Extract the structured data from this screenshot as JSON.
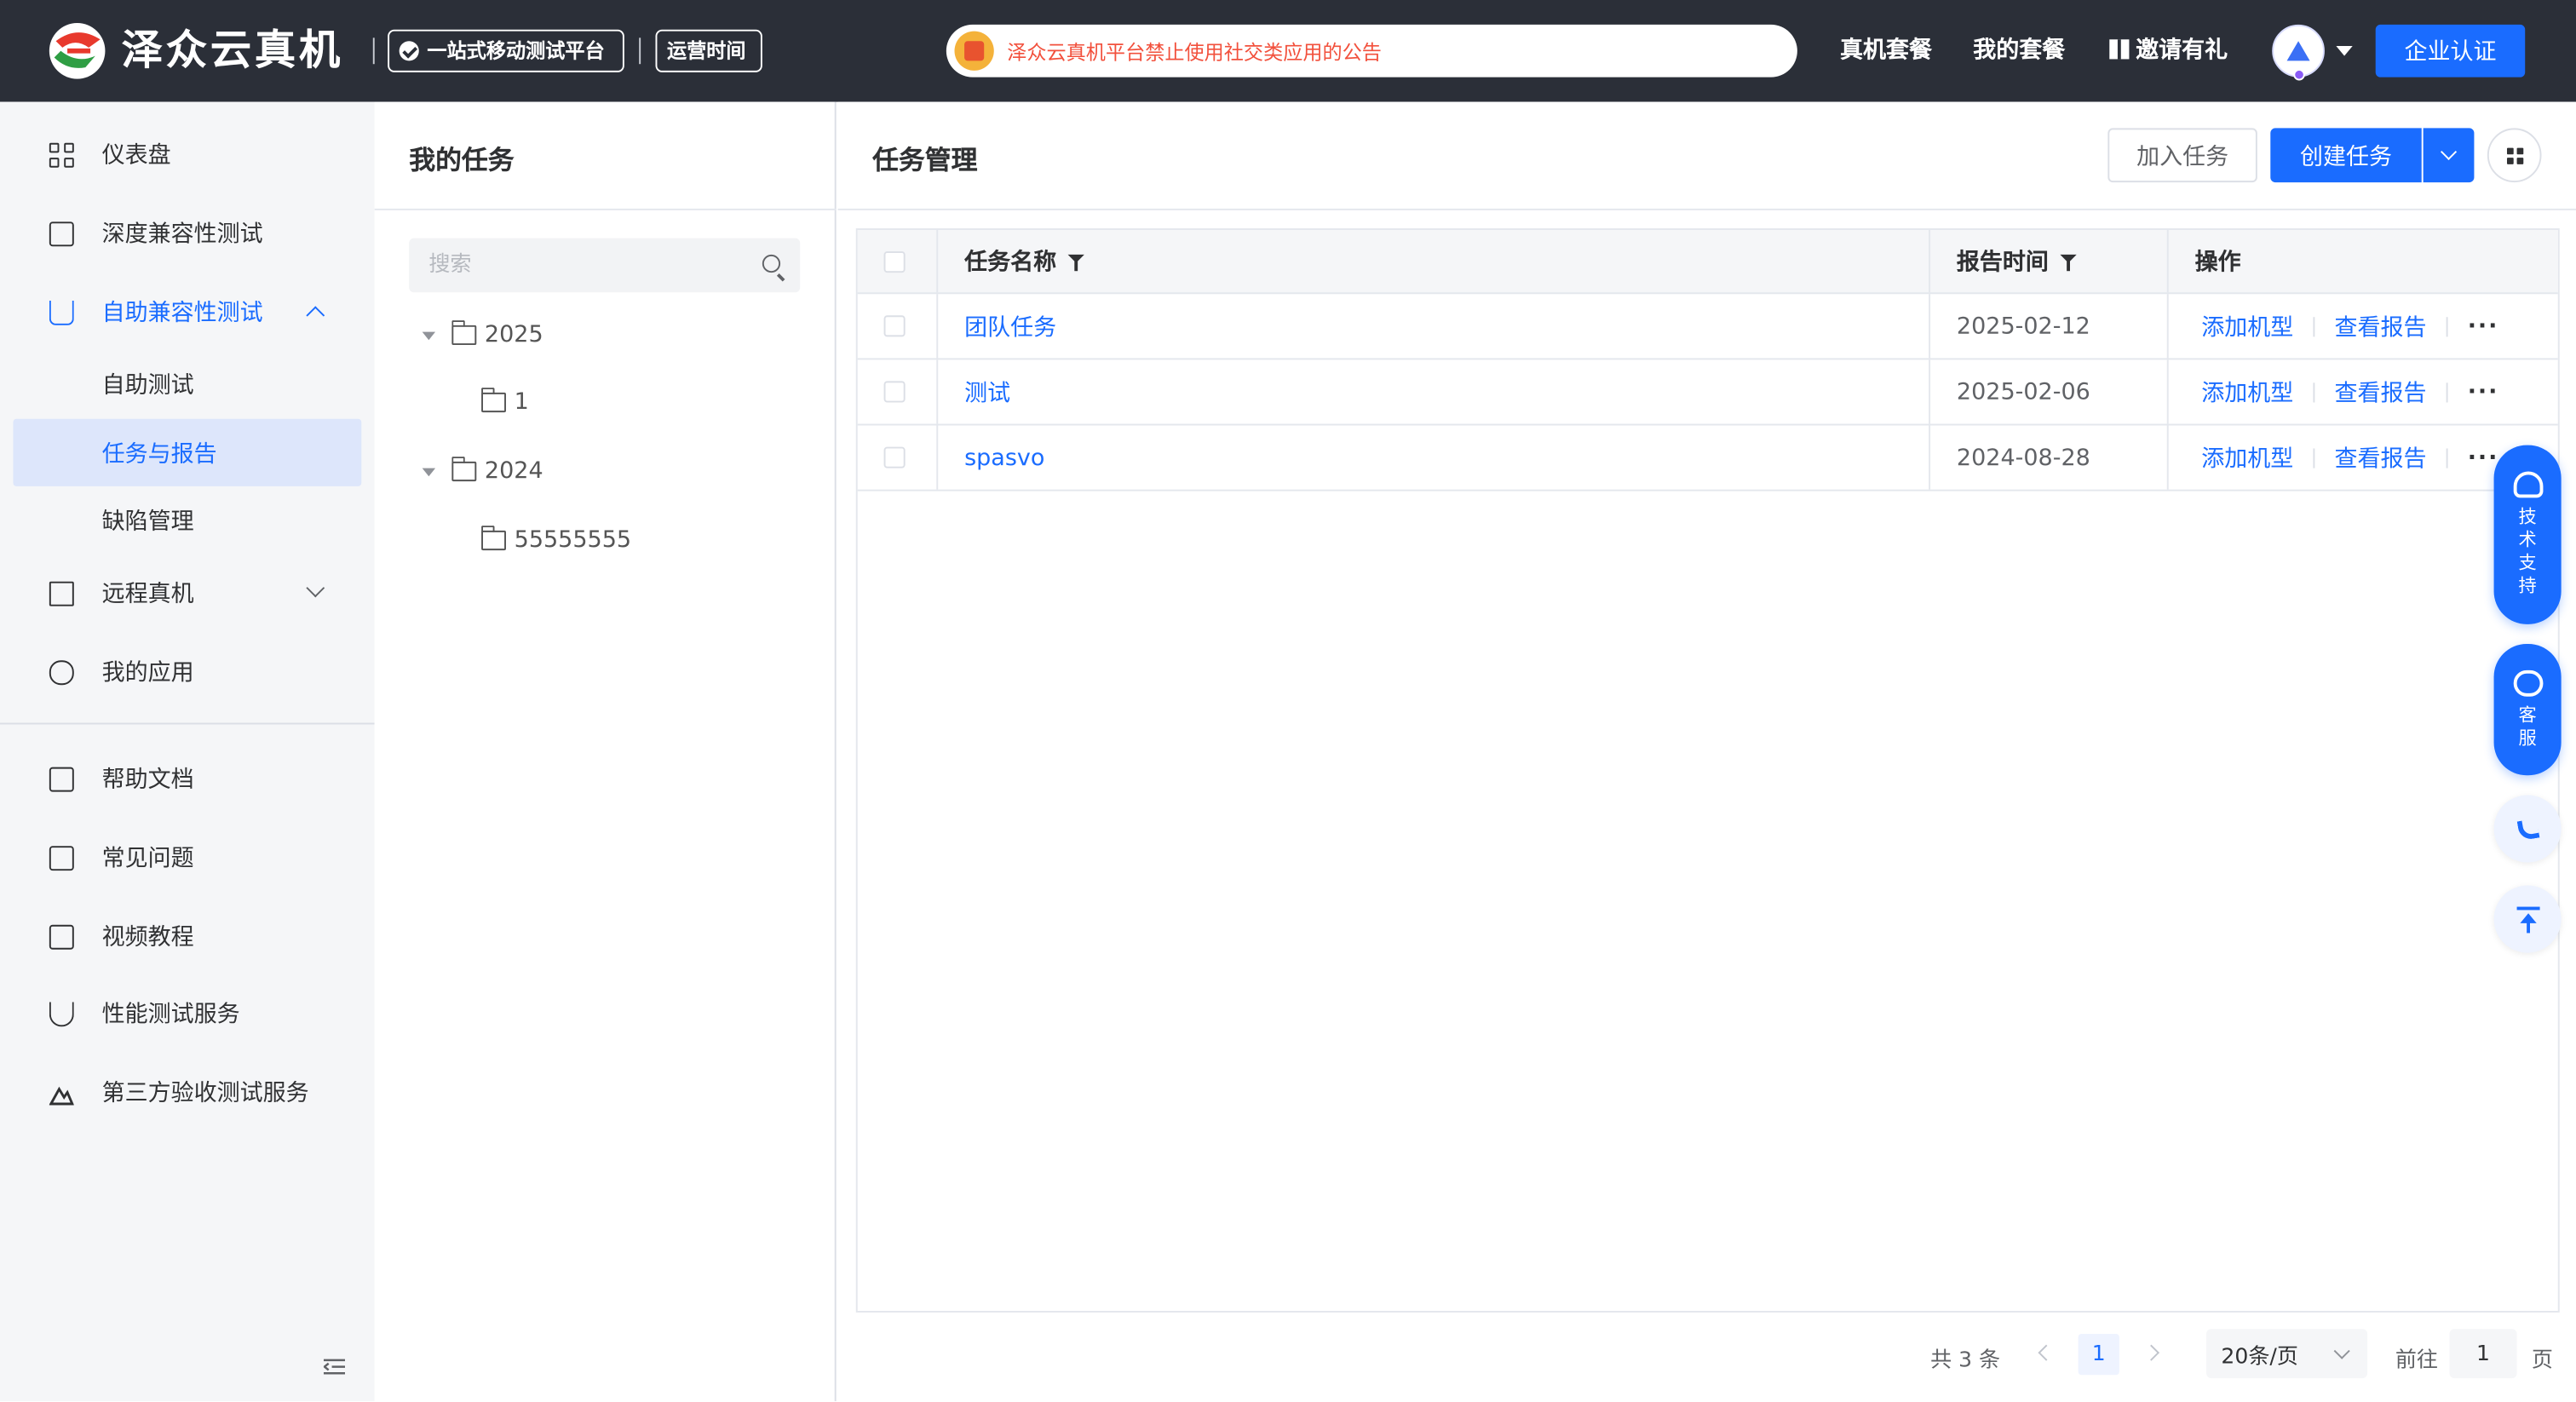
{
  "header": {
    "brand": "泽众云真机",
    "tag_platform": "一站式移动测试平台",
    "tag_hours": "运营时间",
    "notice": "泽众云真机平台禁止使用社交类应用的公告",
    "nav": [
      "真机套餐",
      "我的套餐",
      "邀请有礼"
    ],
    "enterprise_button": "企业认证",
    "avatar_icon": "user-avatar-icon",
    "colors": {
      "bar": "#2b2f38",
      "accent": "#1a6cff",
      "notice_text": "#f2503c"
    }
  },
  "sidebar": {
    "items": [
      {
        "label": "仪表盘",
        "icon": "dashboard-icon"
      },
      {
        "label": "深度兼容性测试",
        "icon": "copy-icon"
      },
      {
        "label": "自助兼容性测试",
        "icon": "flask-icon",
        "expanded": true
      },
      {
        "label": "远程真机",
        "icon": "phone-icon"
      },
      {
        "label": "我的应用",
        "icon": "app-icon"
      },
      {
        "label": "帮助文档",
        "icon": "book-icon"
      },
      {
        "label": "常见问题",
        "icon": "question-icon"
      },
      {
        "label": "视频教程",
        "icon": "video-icon"
      },
      {
        "label": "性能测试服务",
        "icon": "magnet-icon"
      },
      {
        "label": "第三方验收测试服务",
        "icon": "mountain-icon"
      }
    ],
    "sub_items": [
      "自助测试",
      "任务与报告",
      "缺陷管理"
    ],
    "selected": "任务与报告"
  },
  "tree": {
    "title": "我的任务",
    "search_placeholder": "搜索",
    "nodes": [
      {
        "label": "2025",
        "children": [
          "1"
        ]
      },
      {
        "label": "2024",
        "children": [
          "55555555"
        ]
      }
    ]
  },
  "main": {
    "title": "任务管理",
    "join_button": "加入任务",
    "create_button": "创建任务",
    "table": {
      "columns": [
        "任务名称",
        "报告时间",
        "操作"
      ],
      "rows": [
        {
          "name": "团队任务",
          "time": "2025-02-12"
        },
        {
          "name": "测试",
          "time": "2025-02-06"
        },
        {
          "name": "spasvo",
          "time": "2024-08-28"
        }
      ],
      "actions": [
        "添加机型",
        "查看报告",
        "···"
      ]
    },
    "pagination": {
      "total_text": "共 3 条",
      "current_page": "1",
      "page_size": "20条/页",
      "goto_label": "前往",
      "goto_value": "1",
      "page_suffix": "页"
    }
  },
  "float_tools": {
    "tech_support": "技术支持",
    "customer_service": "客服"
  }
}
